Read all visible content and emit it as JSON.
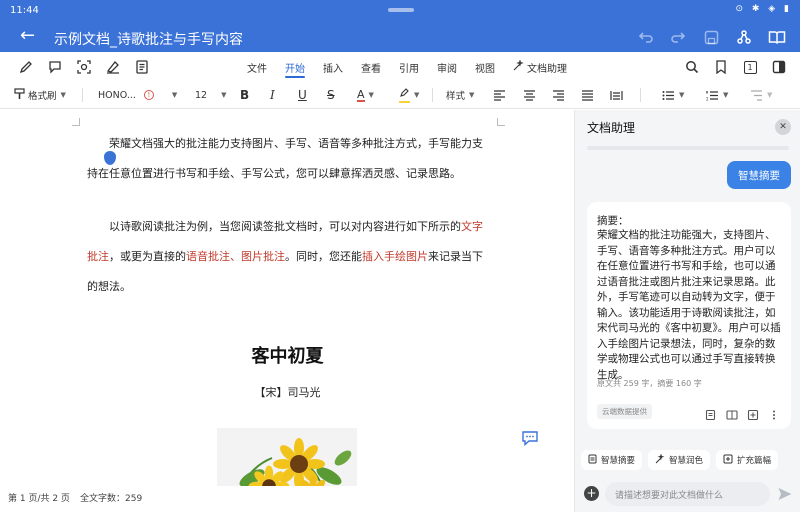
{
  "status_bar": {
    "time": "11:44"
  },
  "title_bar": {
    "title": "示例文档_诗歌批注与手写内容"
  },
  "ribbon": {
    "tabs": [
      {
        "label": "文件"
      },
      {
        "label": "开始",
        "active": true
      },
      {
        "label": "插入"
      },
      {
        "label": "查看"
      },
      {
        "label": "引用"
      },
      {
        "label": "审阅"
      },
      {
        "label": "视图"
      },
      {
        "label": "文档助理"
      }
    ],
    "page_badge": "1"
  },
  "format_bar": {
    "format_painter": "格式刷",
    "font_name": "HONO...",
    "font_size": "12",
    "styles": "样式"
  },
  "document": {
    "para1": "荣耀文档强大的批注能力支持图片、手写、语音等多种批注方式，手写能力支持在任意位置进行书写和手绘、手写公式，您可以肆意挥洒灵感、记录思路。",
    "para2": {
      "t1": "以诗歌阅读批注为例，当您阅读签批文档时，可以对内容进行如下所示的",
      "r1": "文字批注",
      "t2": "，或更为直接的",
      "r2": "语音批注、图片批注",
      "t3": "。同时，您还能",
      "r3": "插入手绘图片",
      "t4": "来记录当下的想法。"
    },
    "poem_title": "客中初夏",
    "poem_author": "【宋】司马光"
  },
  "footer": {
    "page": "第 1 页/共 2 页",
    "word_count": "全文字数：259"
  },
  "assistant": {
    "title": "文档助理",
    "summary_button": "智慧摘要",
    "summary_label": "摘要：",
    "summary_text": "荣耀文档的批注功能强大，支持图片、手写、语音等多种批注方式。用户可以在任意位置进行书写和手绘，也可以通过语音批注或图片批注来记录思路。此外，手写笔迹可以自动转为文字，便于输入。该功能适用于诗歌阅读批注，如宋代司马光的《客中初夏》。用户可以插入手绘图片记录想法，同时，复杂的数学或物理公式也可以通过手写直接转换生成。",
    "stats": "原文共 259 字，摘要 160 字",
    "source": "云端数据提供",
    "chips": [
      {
        "label": "智慧摘要",
        "icon": "summary-icon"
      },
      {
        "label": "智慧润色",
        "icon": "polish-icon"
      },
      {
        "label": "扩充篇幅",
        "icon": "expand-icon"
      }
    ],
    "input_placeholder": "请描述想要对此文档做什么"
  },
  "colors": {
    "brand": "#3a72d8",
    "accent_red": "#c0392b",
    "assist_button": "#3a82e6"
  }
}
